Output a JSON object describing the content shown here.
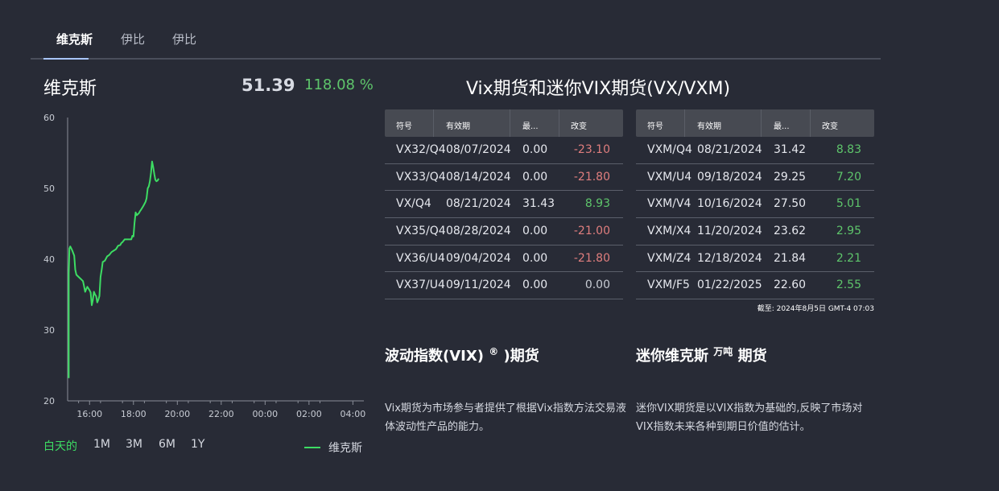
{
  "tabs": [
    {
      "label": "维克斯",
      "active": true
    },
    {
      "label": "伊比",
      "active": false
    },
    {
      "label": "伊比",
      "active": false
    }
  ],
  "quote": {
    "name": "维克斯",
    "price": "51.39",
    "change_pct": "118.08 %"
  },
  "chart_data": {
    "type": "line",
    "series": [
      {
        "name": "维克斯",
        "color": "#3ddc63",
        "points": [
          [
            15.05,
            23.2
          ],
          [
            15.05,
            38
          ],
          [
            15.08,
            41.5
          ],
          [
            15.12,
            41.8
          ],
          [
            15.2,
            41.3
          ],
          [
            15.3,
            40.5
          ],
          [
            15.35,
            38.5
          ],
          [
            15.4,
            37.8
          ],
          [
            15.5,
            37.5
          ],
          [
            15.6,
            37.2
          ],
          [
            15.7,
            36.9
          ],
          [
            15.75,
            36.2
          ],
          [
            15.8,
            35.4
          ],
          [
            15.85,
            35.8
          ],
          [
            15.9,
            36.1
          ],
          [
            16.0,
            35.6
          ],
          [
            16.05,
            35.3
          ],
          [
            16.1,
            33.5
          ],
          [
            16.15,
            34.2
          ],
          [
            16.2,
            35.4
          ],
          [
            16.25,
            35.0
          ],
          [
            16.3,
            34.8
          ],
          [
            16.35,
            33.9
          ],
          [
            16.4,
            34.3
          ],
          [
            16.45,
            34.8
          ],
          [
            16.5,
            37.5
          ],
          [
            16.55,
            38.5
          ],
          [
            16.6,
            39.6
          ],
          [
            16.7,
            39.8
          ],
          [
            16.8,
            40.4
          ],
          [
            16.9,
            40.6
          ],
          [
            17.0,
            41.0
          ],
          [
            17.1,
            41.2
          ],
          [
            17.2,
            41.4
          ],
          [
            17.3,
            41.9
          ],
          [
            17.4,
            42.0
          ],
          [
            17.45,
            42.3
          ],
          [
            17.5,
            42.4
          ],
          [
            17.6,
            42.8
          ],
          [
            17.7,
            42.8
          ],
          [
            17.8,
            42.8
          ],
          [
            17.9,
            42.8
          ],
          [
            17.95,
            43.3
          ],
          [
            18.0,
            43.2
          ],
          [
            18.05,
            45.1
          ],
          [
            18.1,
            46.6
          ],
          [
            18.15,
            46.2
          ],
          [
            18.25,
            46.5
          ],
          [
            18.3,
            46.8
          ],
          [
            18.35,
            47.0
          ],
          [
            18.45,
            47.5
          ],
          [
            18.5,
            47.8
          ],
          [
            18.55,
            48.1
          ],
          [
            18.6,
            48.6
          ],
          [
            18.65,
            50.0
          ],
          [
            18.7,
            50.3
          ],
          [
            18.75,
            51.0
          ],
          [
            18.8,
            52.2
          ],
          [
            18.85,
            53.8
          ],
          [
            18.9,
            53.0
          ],
          [
            18.95,
            52.0
          ],
          [
            19.0,
            51.2
          ],
          [
            19.05,
            51.0
          ],
          [
            19.1,
            51.1
          ],
          [
            19.15,
            51.39
          ]
        ]
      }
    ],
    "x_ticks": [
      "16:00",
      "18:00",
      "20:00",
      "22:00",
      "00:00",
      "02:00",
      "04:00"
    ],
    "y_ticks": [
      "20",
      "30",
      "40",
      "50",
      "60"
    ],
    "ylim": [
      20,
      60
    ],
    "xlim": [
      15.0,
      28.5
    ],
    "grid": false
  },
  "ranges": [
    {
      "label": "白天的",
      "active": true
    },
    {
      "label": "1M",
      "active": false
    },
    {
      "label": "3M",
      "active": false
    },
    {
      "label": "6M",
      "active": false
    },
    {
      "label": "1Y",
      "active": false
    }
  ],
  "main_title": "Vix期货和迷你VIX期货(VX/VXM)",
  "vx_table": {
    "headers": [
      "符号",
      "有效期",
      "最...",
      "改变"
    ],
    "rows": [
      {
        "symbol": "VX32/Q4",
        "expiry": "08/07/2024",
        "last": "0.00",
        "change": "-23.10",
        "tone": "neg"
      },
      {
        "symbol": "VX33/Q4",
        "expiry": "08/14/2024",
        "last": "0.00",
        "change": "-21.80",
        "tone": "neg"
      },
      {
        "symbol": "VX/Q4",
        "expiry": "08/21/2024",
        "last": "31.43",
        "change": "8.93",
        "tone": "pos"
      },
      {
        "symbol": "VX35/Q4",
        "expiry": "08/28/2024",
        "last": "0.00",
        "change": "-21.00",
        "tone": "neg"
      },
      {
        "symbol": "VX36/U4",
        "expiry": "09/04/2024",
        "last": "0.00",
        "change": "-21.80",
        "tone": "neg"
      },
      {
        "symbol": "VX37/U4",
        "expiry": "09/11/2024",
        "last": "0.00",
        "change": "0.00",
        "tone": "zero"
      }
    ]
  },
  "vxm_table": {
    "headers": [
      "符号",
      "有效期",
      "最...",
      "改变"
    ],
    "rows": [
      {
        "symbol": "VXM/Q4",
        "expiry": "08/21/2024",
        "last": "31.42",
        "change": "8.83",
        "tone": "pos"
      },
      {
        "symbol": "VXM/U4",
        "expiry": "09/18/2024",
        "last": "29.25",
        "change": "7.20",
        "tone": "pos"
      },
      {
        "symbol": "VXM/V4",
        "expiry": "10/16/2024",
        "last": "27.50",
        "change": "5.01",
        "tone": "pos"
      },
      {
        "symbol": "VXM/X4",
        "expiry": "11/20/2024",
        "last": "23.62",
        "change": "2.95",
        "tone": "pos"
      },
      {
        "symbol": "VXM/Z4",
        "expiry": "12/18/2024",
        "last": "21.84",
        "change": "2.21",
        "tone": "pos"
      },
      {
        "symbol": "VXM/F5",
        "expiry": "01/22/2025",
        "last": "22.60",
        "change": "2.55",
        "tone": "pos"
      }
    ]
  },
  "as_of": "截至: 2024年8月5日 GMT-4 07:03",
  "sections": {
    "vix": {
      "title": "波动指数(VIX)",
      "sup": "®",
      "title_suffix": ")期货",
      "desc": "Vix期货为市场参与者提供了根据Vix指数方法交易液体波动性产品的能力。"
    },
    "mini": {
      "title": "迷你维克斯",
      "sup": "万吨",
      "title_suffix": "期货",
      "desc": "迷你VIX期货是以VIX指数为基础的,反映了市场对VIX指数未来各种到期日价值的估计。"
    }
  },
  "colors": {
    "accent_green": "#3ddc63",
    "negative": "#e07e7e",
    "background": "#282b36"
  }
}
